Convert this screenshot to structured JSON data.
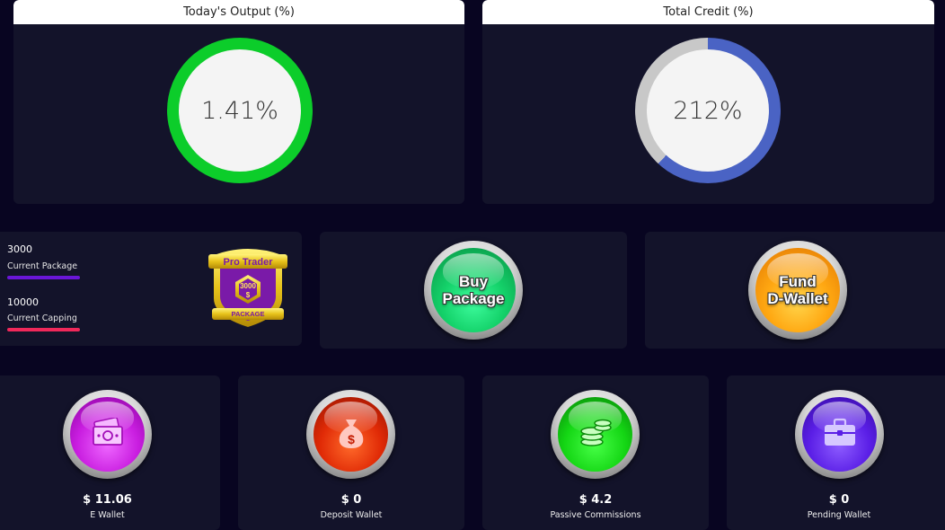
{
  "todays_output": {
    "title": "Today's Output (%)",
    "value_text": "1.41%",
    "ring_color": "#0ccd2a"
  },
  "total_credit": {
    "title": "Total Credit (%)",
    "value_text": "212%",
    "fill_fraction": 0.62,
    "fill_color": "#4a63c4",
    "track_color": "#c8c8c8"
  },
  "package": {
    "current_value": "3000",
    "current_label": "Current Package",
    "current_bar_color": "#6a16d8",
    "capping_value": "10000",
    "capping_label": "Current Capping",
    "capping_bar_color": "#f0285a",
    "badge": {
      "title": "Pro Trader",
      "amount": "3000",
      "currency": "$",
      "footer": "PACKAGE"
    }
  },
  "actions": {
    "buy_package_line1": "Buy",
    "buy_package_line2": "Package",
    "fund_wallet_line1": "Fund",
    "fund_wallet_line2": "D-Wallet"
  },
  "wallets": [
    {
      "amount": "$ 11.06",
      "label": "E Wallet",
      "icon": "cash-stack-icon"
    },
    {
      "amount": "$ 0",
      "label": "Deposit Wallet",
      "icon": "money-bag-icon"
    },
    {
      "amount": "$ 4.2",
      "label": "Passive Commissions",
      "icon": "coins-stack-icon"
    },
    {
      "amount": "$ 0",
      "label": "Pending Wallet",
      "icon": "briefcase-icon"
    }
  ]
}
